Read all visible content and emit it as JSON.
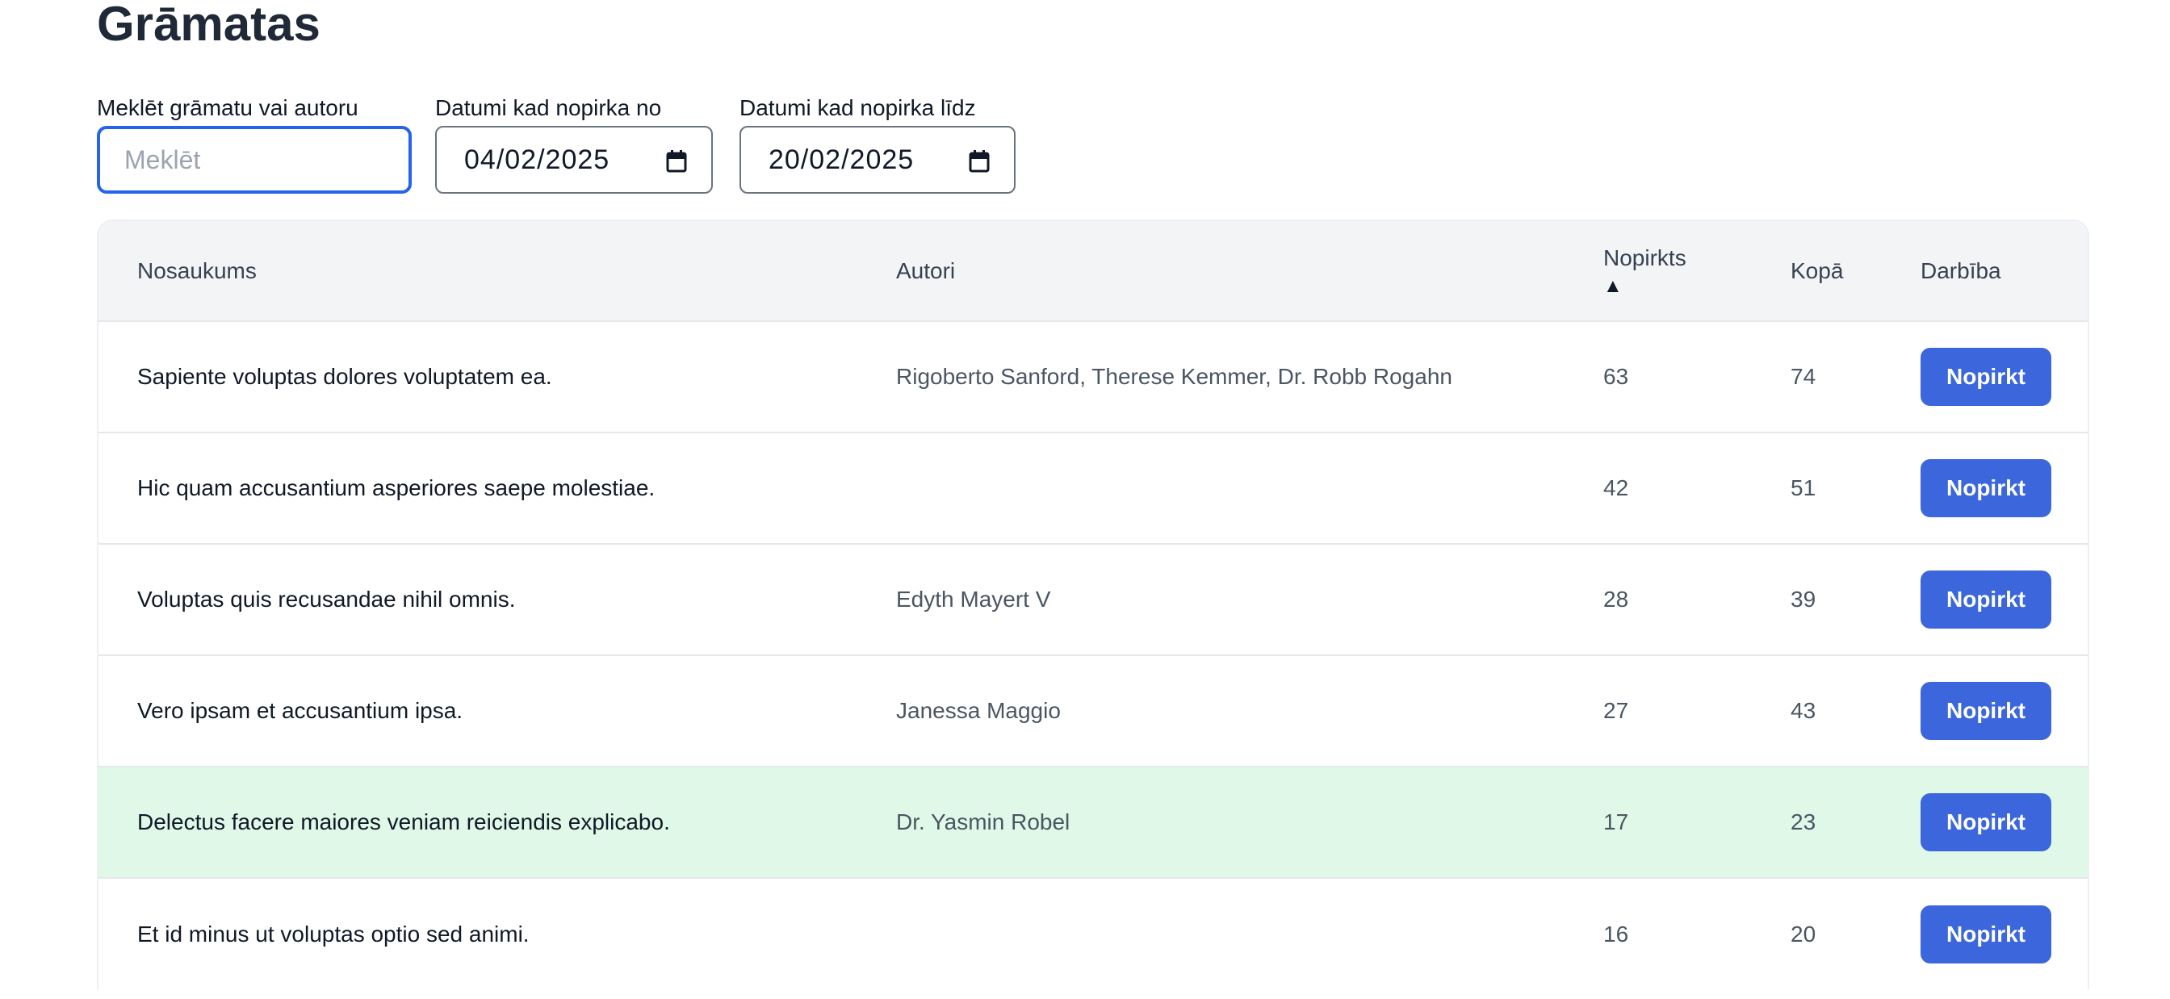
{
  "page": {
    "title": "Grāmatas"
  },
  "filters": {
    "search_label": "Meklēt grāmatu vai autoru",
    "search_placeholder": "Meklēt",
    "search_value": "",
    "date_from_label": "Datumi kad nopirka no",
    "date_from_value": "04/02/2025",
    "date_to_label": "Datumi kad nopirka līdz",
    "date_to_value": "20/02/2025"
  },
  "table": {
    "headers": {
      "name": "Nosaukums",
      "authors": "Autori",
      "bought": "Nopirkts",
      "bought_sort": "▲",
      "total": "Kopā",
      "action": "Darbība"
    },
    "action_label": "Nopirkt",
    "rows": [
      {
        "name": "Sapiente voluptas dolores voluptatem ea.",
        "authors": "Rigoberto Sanford, Therese Kemmer, Dr. Robb Rogahn",
        "bought": "63",
        "total": "74",
        "highlight": false
      },
      {
        "name": "Hic quam accusantium asperiores saepe molestiae.",
        "authors": "",
        "bought": "42",
        "total": "51",
        "highlight": false
      },
      {
        "name": "Voluptas quis recusandae nihil omnis.",
        "authors": "Edyth Mayert V",
        "bought": "28",
        "total": "39",
        "highlight": false
      },
      {
        "name": "Vero ipsam et accusantium ipsa.",
        "authors": "Janessa Maggio",
        "bought": "27",
        "total": "43",
        "highlight": false
      },
      {
        "name": "Delectus facere maiores veniam reiciendis explicabo.",
        "authors": "Dr. Yasmin Robel",
        "bought": "17",
        "total": "23",
        "highlight": true
      },
      {
        "name": "Et id minus ut voluptas optio sed animi.",
        "authors": "",
        "bought": "16",
        "total": "20",
        "highlight": false
      }
    ]
  },
  "colors": {
    "accent": "#3b66dc",
    "focus_border": "#2563eb",
    "highlight_row": "#e0f8e8",
    "header_bg": "#f3f4f6"
  },
  "icons": {
    "date_picker": "calendar-icon"
  }
}
